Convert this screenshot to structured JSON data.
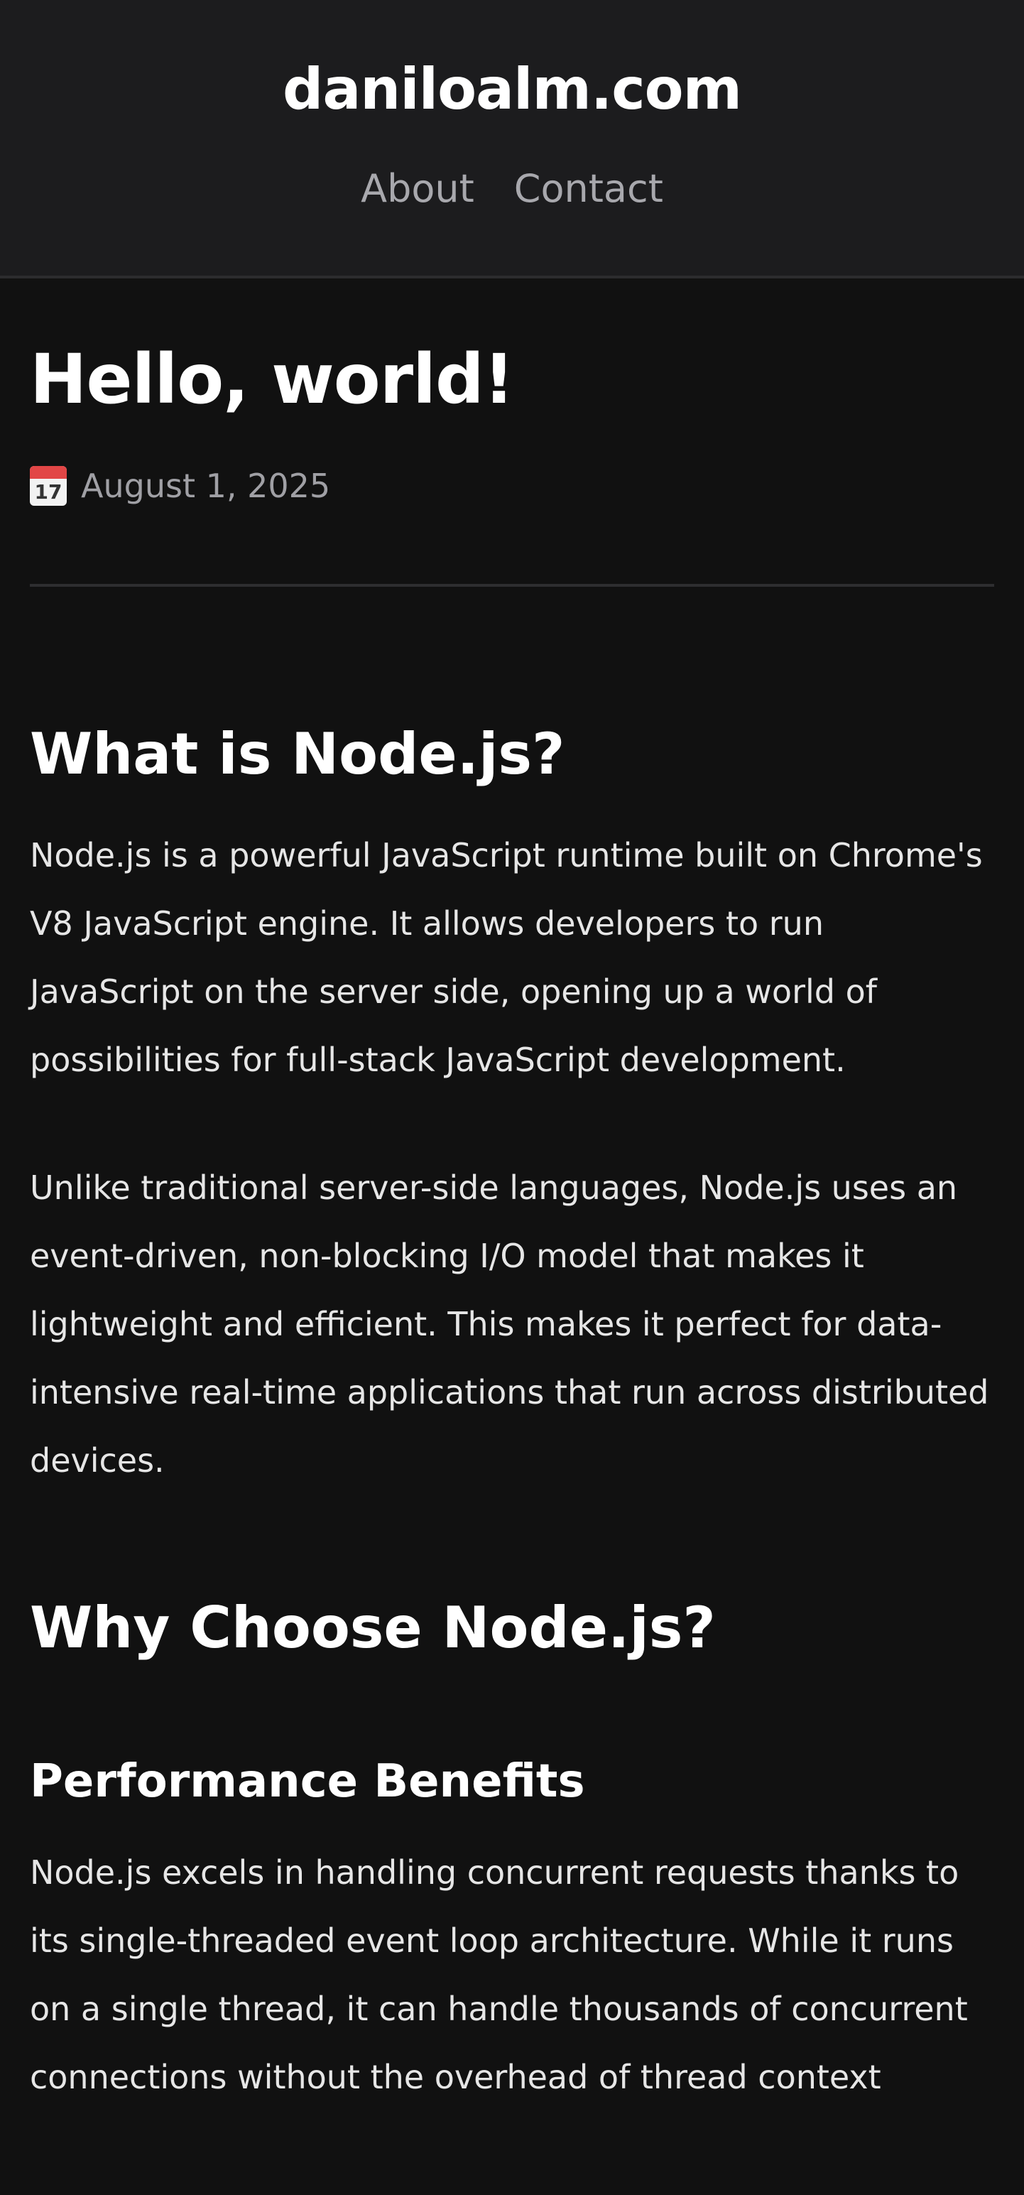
{
  "site": {
    "title": "daniloalm.com",
    "nav": [
      {
        "label": "About"
      },
      {
        "label": "Contact"
      }
    ]
  },
  "post": {
    "title": "Hello, world!",
    "date": "August 1, 2025",
    "calendar_icon": {
      "name": "calendar-icon",
      "day": "17"
    },
    "sections": {
      "what_is": {
        "heading": "What is Node.js?",
        "paragraphs": [
          "Node.js is a powerful JavaScript runtime built on Chrome's V8 JavaScript engine. It allows developers to run JavaScript on the server side, opening up a world of possibilities for full-stack JavaScript development.",
          "Unlike traditional server-side languages, Node.js uses an event-driven, non-blocking I/O model that makes it lightweight and efficient. This makes it perfect for data-intensive real-time applications that run across distributed devices."
        ]
      },
      "why_choose": {
        "heading": "Why Choose Node.js?",
        "subheading": "Performance Benefits",
        "paragraph": "Node.js excels in handling concurrent requests thanks to its single-threaded event loop architecture. While it runs on a single thread, it can handle thousands of concurrent connections without the overhead of thread context"
      }
    }
  },
  "colors": {
    "background": "#111111",
    "header_background": "#1c1c1e",
    "nav_text": "#a8a8ad",
    "text": "#e6e6e6"
  }
}
